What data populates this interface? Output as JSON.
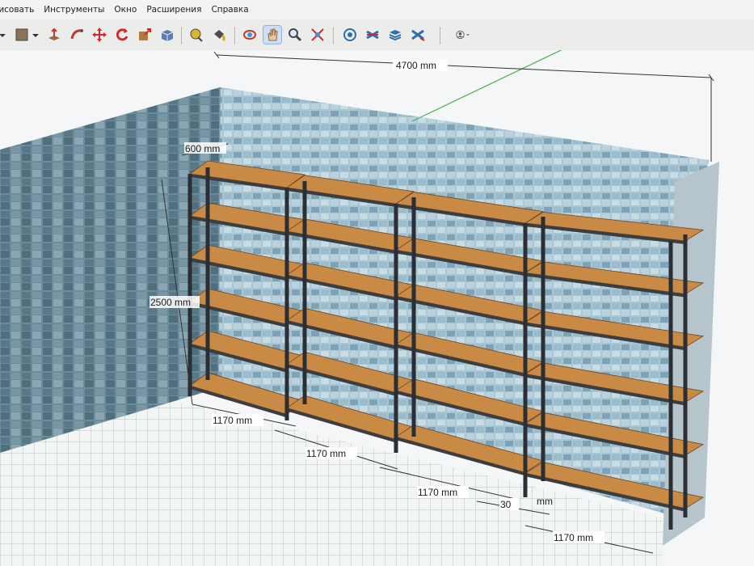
{
  "menu": {
    "items": [
      "Рисовать",
      "Инструменты",
      "Окно",
      "Расширения",
      "Справка"
    ]
  },
  "toolbar": {
    "tools": [
      "paint-bucket-icon",
      "material-swatch-icon",
      "push-pull-icon",
      "follow-me-icon",
      "move-icon",
      "rotate-icon",
      "scale-icon",
      "component-icon",
      "tape-measure-icon",
      "paint-icon",
      "orbit-icon",
      "pan-icon",
      "zoom-icon",
      "zoom-extents-icon",
      "warehouse-icon",
      "extension-warehouse-icon",
      "layers-icon",
      "sandbox-icon",
      "account-icon"
    ]
  },
  "dimensions": {
    "total_width": "4700 mm",
    "depth": "600 mm",
    "height": "2500 mm",
    "bay_1": "1170 mm",
    "bay_2": "1170 mm",
    "bay_3": "1170 mm",
    "bay_4": "1170 mm",
    "gap": "30",
    "gap_unit": "mm"
  },
  "colors": {
    "shelf": "#c98a45",
    "frame": "#2b2e33",
    "wall": "#7f9cab",
    "floor": "#f0f2f2",
    "toolbar": "#ececea",
    "axis_green": "#4caf50"
  }
}
